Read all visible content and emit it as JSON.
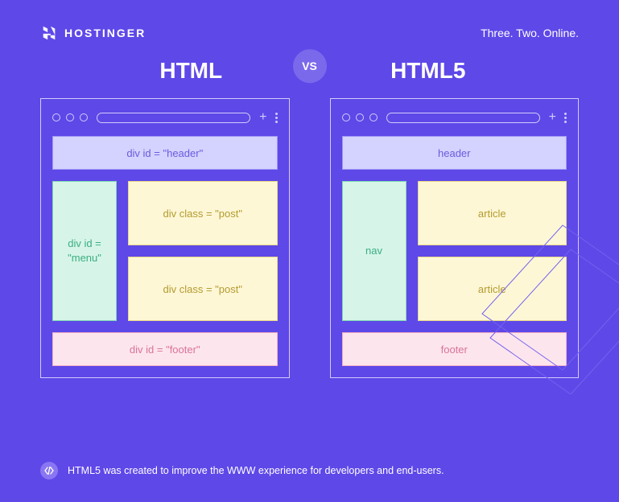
{
  "brand": {
    "name": "HOSTINGER",
    "tagline": "Three. Two. Online."
  },
  "titles": {
    "left": "HTML",
    "right": "HTML5",
    "vs": "VS"
  },
  "left_panel": {
    "header": "div id = \"header\"",
    "menu": "div id = \"menu\"",
    "post": "div class = \"post\"",
    "footer": "div id = \"footer\""
  },
  "right_panel": {
    "header": "header",
    "menu": "nav",
    "post": "article",
    "footer": "footer"
  },
  "footnote": "HTML5 was created to improve the WWW experience for developers and end-users."
}
